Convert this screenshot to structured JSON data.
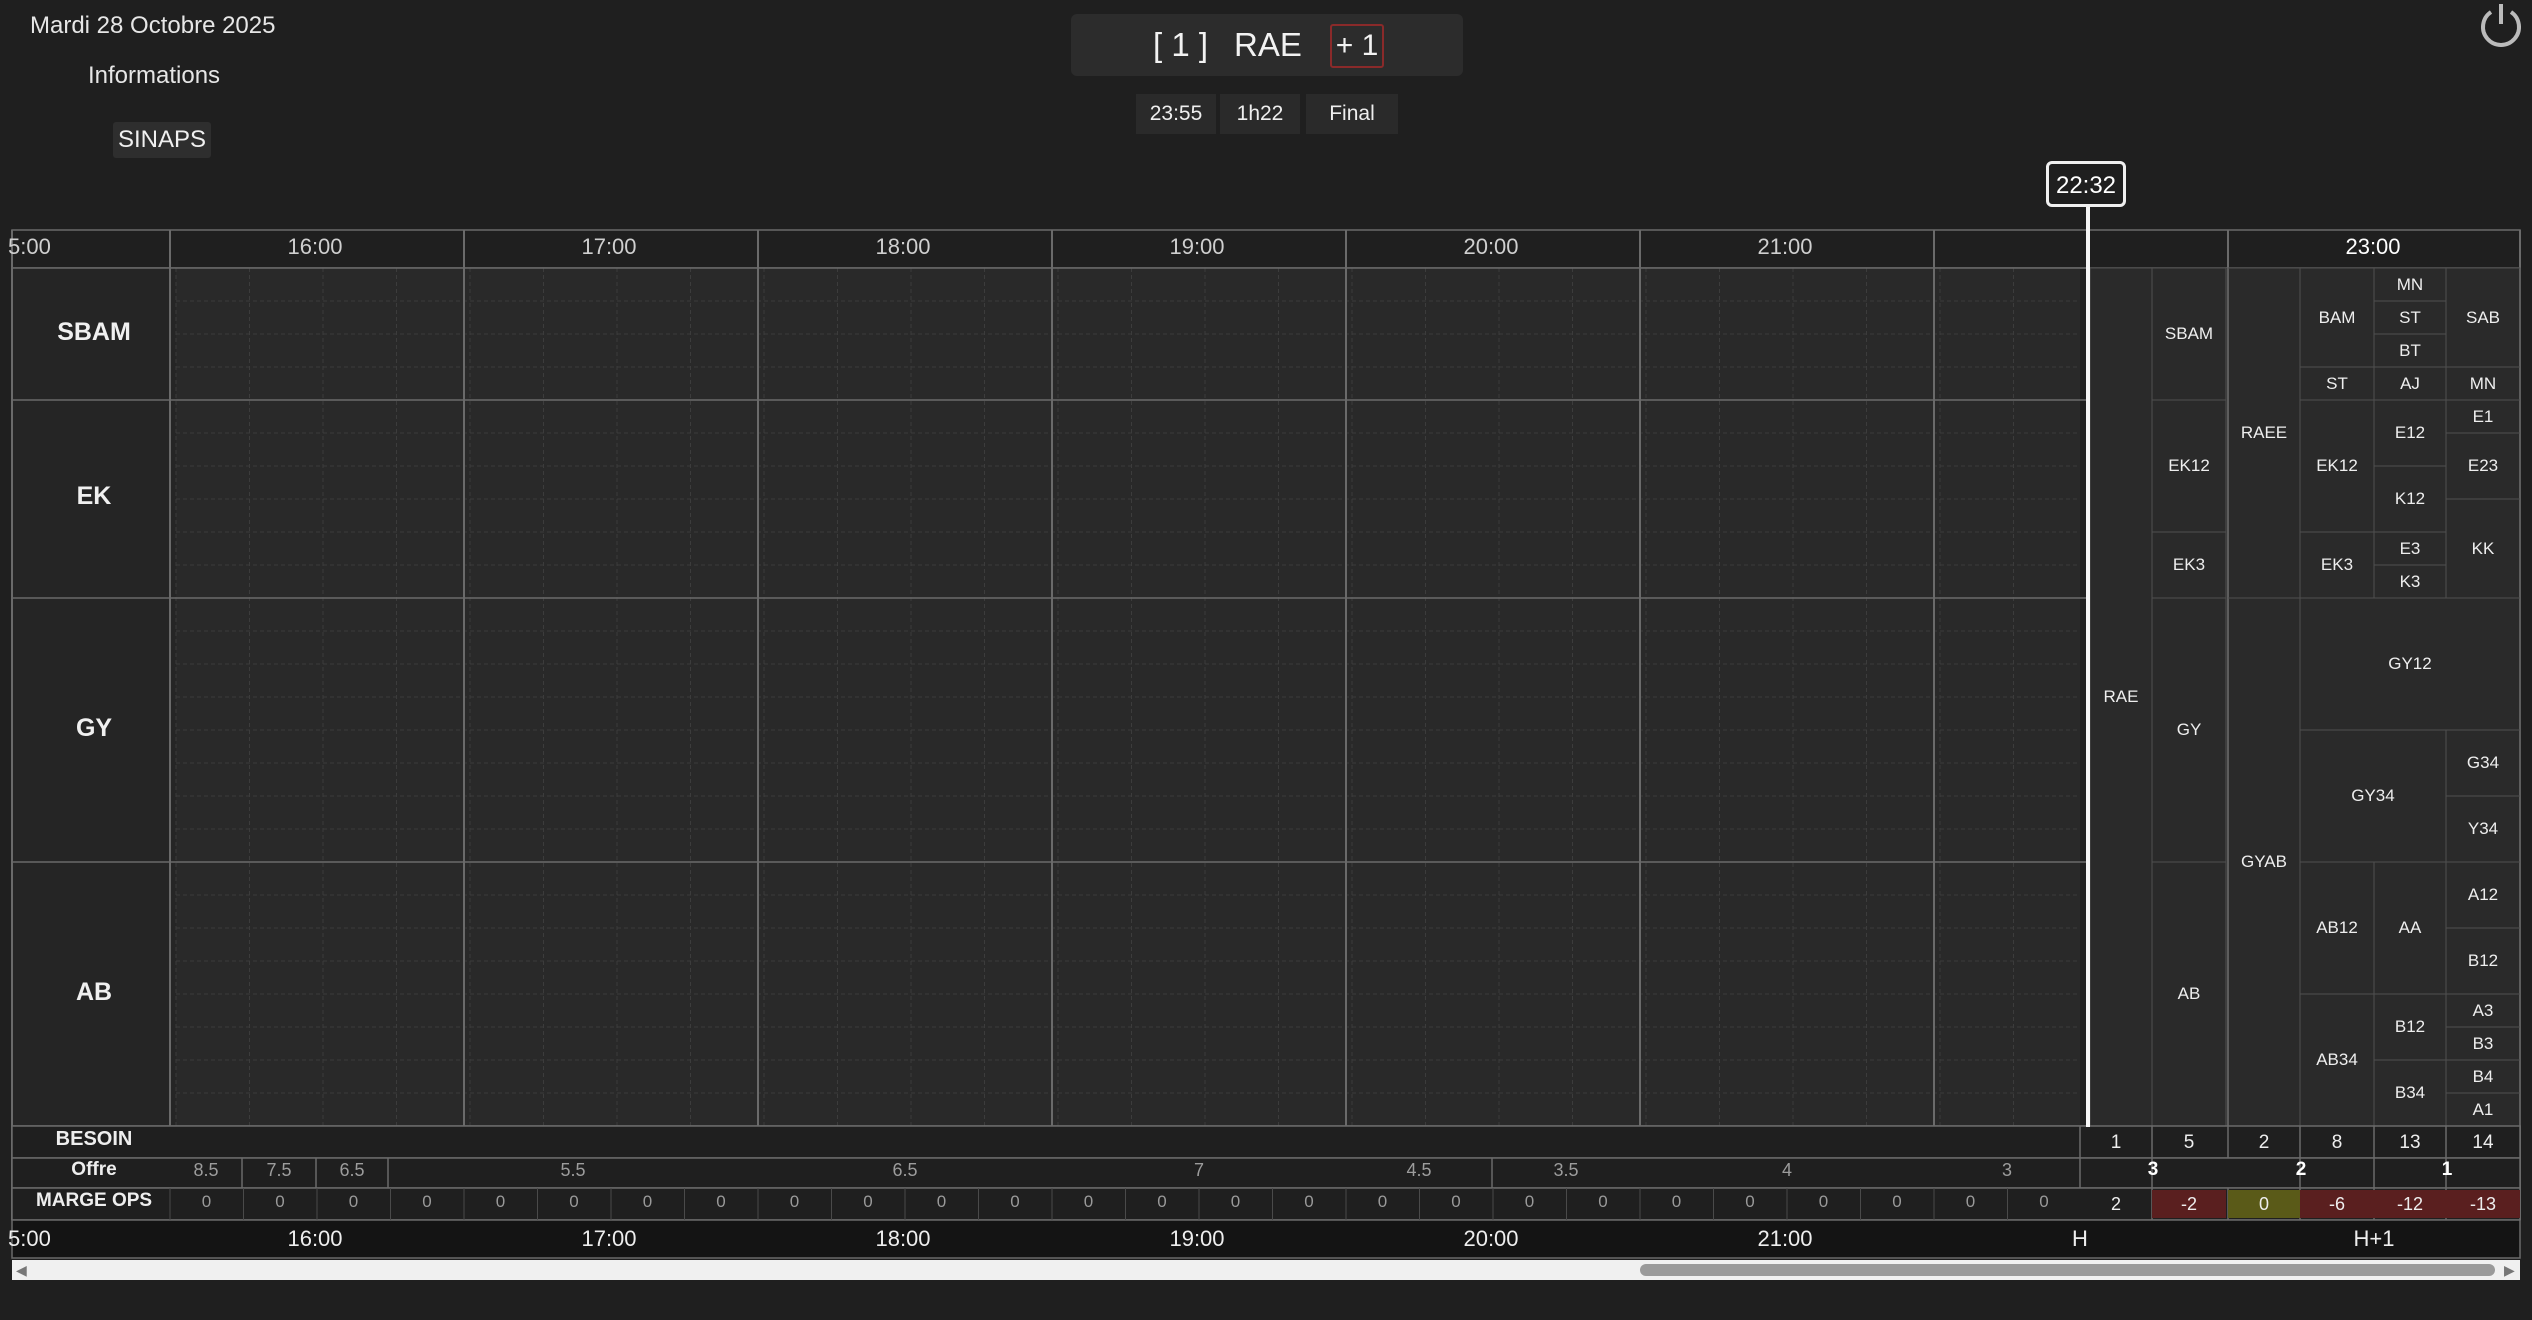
{
  "header": {
    "date": "Mardi 28 Octobre 2025",
    "info_link": "Informations",
    "sinaps_button": "SINAPS",
    "bracket": "[ 1 ]",
    "config": "RAE",
    "plus": "+ 1",
    "time": "23:55",
    "duration": "1h22",
    "status": "Final"
  },
  "now_marker": "22:32",
  "hours": [
    "5:00",
    "16:00",
    "17:00",
    "18:00",
    "19:00",
    "20:00",
    "21:00",
    "",
    "23:00"
  ],
  "bottom_hours": [
    "5:00",
    "16:00",
    "17:00",
    "18:00",
    "19:00",
    "20:00",
    "21:00",
    "H",
    "H+1"
  ],
  "rows": [
    "SBAM",
    "EK",
    "GY",
    "AB"
  ],
  "sectors": {
    "col_rae": [
      "RAE"
    ],
    "col_h": [
      "SBAM",
      "EK12",
      "EK3",
      "GY",
      "AB"
    ],
    "col_raee": [
      "RAEE",
      "GYAB"
    ],
    "col_a": [
      "BAM",
      "ST",
      "EK12",
      "EK3",
      "AB12",
      "AB34"
    ],
    "col_b": [
      "MN",
      "ST",
      "BT",
      "AJ",
      "E12",
      "K12",
      "E3",
      "K3",
      "AA",
      "B12",
      "B34"
    ],
    "col_c": [
      "SAB",
      "MN",
      "E1",
      "E23",
      "KK",
      "G34",
      "Y34",
      "A12",
      "B12",
      "A3",
      "B3",
      "B4",
      "A1"
    ],
    "gy12": "GY12",
    "gy34": "GY34"
  },
  "besoin": {
    "label": "BESOIN",
    "values": [
      "1",
      "5",
      "2",
      "8",
      "13",
      "14"
    ]
  },
  "offre": {
    "label": "Offre",
    "values": [
      "8.5",
      "7.5",
      "6.5",
      "5.5",
      "6.5",
      "7",
      "4.5",
      "3.5",
      "4",
      "3",
      "3",
      "2",
      "1"
    ]
  },
  "marge": {
    "label": "MARGE OPS",
    "zeros": [
      "0",
      "0",
      "0",
      "0",
      "0",
      "0",
      "0",
      "0",
      "0",
      "0",
      "0",
      "0",
      "0",
      "0",
      "0",
      "0",
      "0",
      "0",
      "0",
      "0",
      "0",
      "0",
      "0",
      "0",
      "0",
      "0"
    ],
    "right": [
      "2",
      "-2",
      "0",
      "-6",
      "-12",
      "-13"
    ]
  },
  "colors": {
    "bg": "#1f1f1f",
    "cell": "#292929",
    "line": "#6a6a6a",
    "neg": "#5a1f1f",
    "zero_warn": "#5a5a18"
  }
}
